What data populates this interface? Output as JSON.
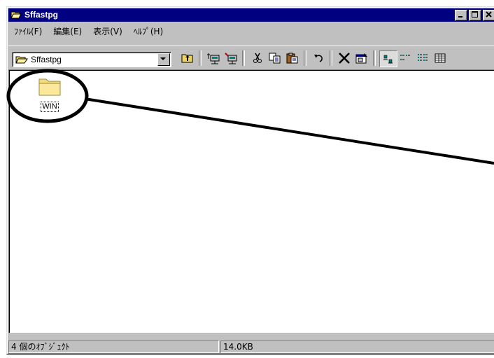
{
  "window": {
    "title": "Sffastpg"
  },
  "menu": [
    {
      "label": "ﾌｧｲﾙ(F)"
    },
    {
      "label": "編集(E)"
    },
    {
      "label": "表示(V)"
    },
    {
      "label": "ﾍﾙﾌﾟ(H)"
    }
  ],
  "toolbar": {
    "address_value": "Sffastpg"
  },
  "content": {
    "items": [
      {
        "label": "WIN",
        "icon": "folder-icon"
      }
    ]
  },
  "status": {
    "objects": "4 個のｵﾌﾞｼﾞｪｸﾄ",
    "size": "14.0KB"
  },
  "colors": {
    "titlebar": "#000080",
    "face": "#c0c0c0",
    "annotation": "#000000"
  }
}
